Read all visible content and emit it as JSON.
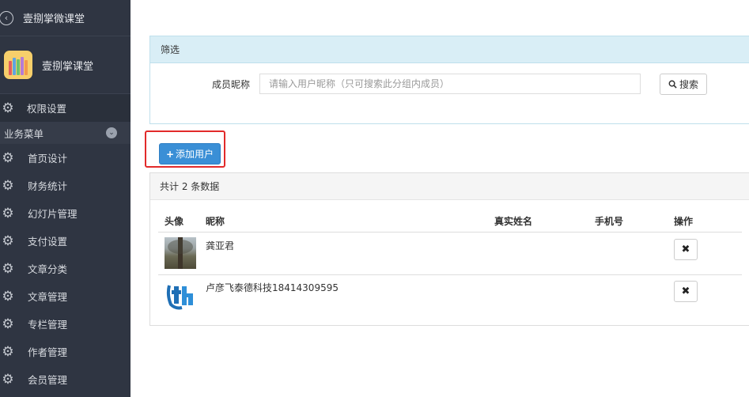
{
  "sidebar": {
    "top_title": "壹捌掌微课堂",
    "brand_name": "壹捌掌课堂",
    "permission_item": "权限设置",
    "group_label": "业务菜单",
    "items": [
      {
        "label": "首页设计"
      },
      {
        "label": "财务统计"
      },
      {
        "label": "幻灯片管理"
      },
      {
        "label": "支付设置"
      },
      {
        "label": "文章分类"
      },
      {
        "label": "文章管理"
      },
      {
        "label": "专栏管理"
      },
      {
        "label": "作者管理"
      },
      {
        "label": "会员管理"
      }
    ]
  },
  "filter": {
    "title": "筛选",
    "label": "成员昵称",
    "placeholder": "请输入用户昵称（只可搜索此分组内成员）",
    "search_label": "搜索"
  },
  "add_button": {
    "label": "添加用户"
  },
  "list": {
    "summary": "共计 2 条数据",
    "columns": [
      "头像",
      "昵称",
      "真实姓名",
      "手机号",
      "操作"
    ],
    "rows": [
      {
        "nickname": "龚亚君",
        "real_name": "",
        "phone": "",
        "delete_label": "✖"
      },
      {
        "nickname": "卢彦飞泰德科技18414309595",
        "real_name": "",
        "phone": "",
        "delete_label": "✖"
      }
    ]
  },
  "colors": {
    "sidebar_bg": "#2f3542",
    "primary": "#3a8fd6",
    "highlight": "#e22a2a",
    "filter_head": "#d9eef6"
  }
}
